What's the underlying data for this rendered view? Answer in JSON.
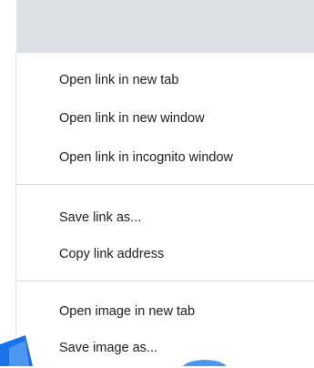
{
  "context_menu": {
    "items": [
      {
        "label": "Open link in new tab"
      },
      {
        "label": "Open link in new window"
      },
      {
        "label": "Open link in incognito window"
      },
      {
        "label": "Save link as..."
      },
      {
        "label": "Copy link address"
      },
      {
        "label": "Open image in new tab"
      },
      {
        "label": "Save image as..."
      }
    ]
  },
  "colors": {
    "header_strip": "#dcdfe6",
    "menu_bg": "#ffffff",
    "text": "#202124",
    "separator": "#d8d8d8",
    "accent_blue": "#1a73e8"
  }
}
